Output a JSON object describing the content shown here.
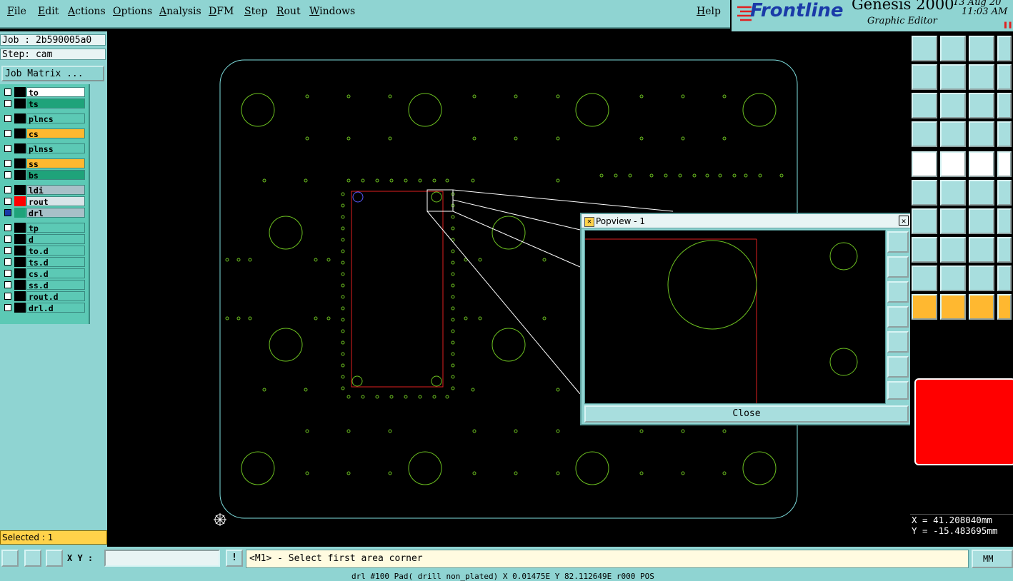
{
  "menu": {
    "items": [
      "File",
      "Edit",
      "Actions",
      "Options",
      "Analysis",
      "DFM",
      "Step",
      "Rout",
      "Windows"
    ],
    "help": "Help"
  },
  "brand": {
    "logo": "Frontline",
    "product": "Genesis 2000",
    "subtitle": "Graphic Editor",
    "date": "13 Aug 20",
    "time": "11:03 AM"
  },
  "job": {
    "job_line": "Job : 2b590005a0",
    "step_line": "Step: cam",
    "matrix_button": "Job Matrix ..."
  },
  "layers": [
    {
      "name": "to",
      "color": "#ffffff"
    },
    {
      "name": "ts",
      "color": "#1fa37a"
    },
    {
      "name": "plncs",
      "color": "#5cc9b5"
    },
    {
      "name": "cs",
      "color": "#ffb830"
    },
    {
      "name": "plnss",
      "color": "#5cc9b5"
    },
    {
      "name": "ss",
      "color": "#ffb830"
    },
    {
      "name": "bs",
      "color": "#1fa37a"
    },
    {
      "name": "ldi",
      "color": "#a8c0c8"
    },
    {
      "name": "rout",
      "color": "#d8e4e8"
    },
    {
      "name": "drl",
      "color": "#a8c0c8"
    },
    {
      "name": "tp",
      "color": "#5cc9b5"
    },
    {
      "name": "d",
      "color": "#5cc9b5"
    },
    {
      "name": "to.d",
      "color": "#5cc9b5"
    },
    {
      "name": "ts.d",
      "color": "#5cc9b5"
    },
    {
      "name": "cs.d",
      "color": "#5cc9b5"
    },
    {
      "name": "ss.d",
      "color": "#5cc9b5"
    },
    {
      "name": "rout.d",
      "color": "#5cc9b5"
    },
    {
      "name": "drl.d",
      "color": "#5cc9b5"
    }
  ],
  "selected": "Selected : 1",
  "popview": {
    "title": "Popview - 1",
    "close": "Close"
  },
  "coords": {
    "x": "X =  41.208040mm",
    "y": "Y = -15.483695mm"
  },
  "bottom": {
    "xy_label": "X Y :",
    "xy_value": "",
    "prompt": "<M1> - Select first area corner",
    "unit": "MM",
    "status": "drl #100 Pad( drill non_plated) X 0.01475E  Y 82.112649E r000 POS"
  },
  "colors": {
    "panel": "#8fd4d2",
    "outline": "#7fe0e0",
    "pad": "#6cc020",
    "highlight": "#e02020"
  }
}
